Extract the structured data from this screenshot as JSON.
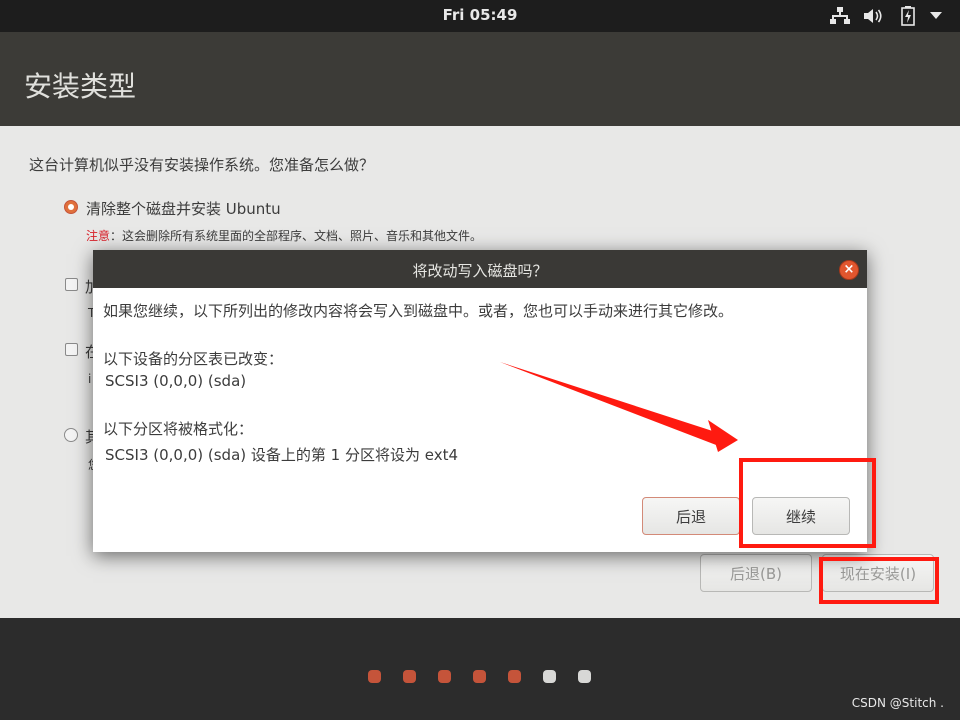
{
  "topbar": {
    "clock": "Fri 05:49",
    "icons": [
      "network-icon",
      "volume-icon",
      "battery-icon",
      "menu-arrow-icon"
    ]
  },
  "header": {
    "title": "安装类型"
  },
  "content": {
    "question": "这台计算机似乎没有安装操作系统。您准备怎么做？",
    "option1": {
      "label": "清除整个磁盘并安装 Ubuntu",
      "note_prefix": "注意",
      "note_text": "：这会删除所有系统里面的全部程序、文档、照片、音乐和其他文件。"
    },
    "option2_peek": "加",
    "option2_sub": "T",
    "option3_peek": "在",
    "option3_sub": "i",
    "option4_peek": "其",
    "option4_sub": "您",
    "back_button": "后退(B)",
    "install_button": "现在安装(I)"
  },
  "dialog": {
    "title": "将改动写入磁盘吗？",
    "intro": "如果您继续，以下所列出的修改内容将会写入到磁盘中。或者，您也可以手动来进行其它修改。",
    "changed_heading": "以下设备的分区表已改变：",
    "changed_device": "SCSI3 (0,0,0) (sda)",
    "format_heading": "以下分区将被格式化：",
    "format_device": "SCSI3 (0,0,0) (sda) 设备上的第 1 分区将设为 ext4",
    "back_button": "后退",
    "continue_button": "继续",
    "close_symbol": "×"
  },
  "progress": {
    "steps_total": 7,
    "steps_done": 5
  },
  "watermark": "CSDN @Stitch .",
  "colors": {
    "accent": "#e0703c",
    "warning": "#d8202a",
    "annotation": "#ff1a10"
  }
}
